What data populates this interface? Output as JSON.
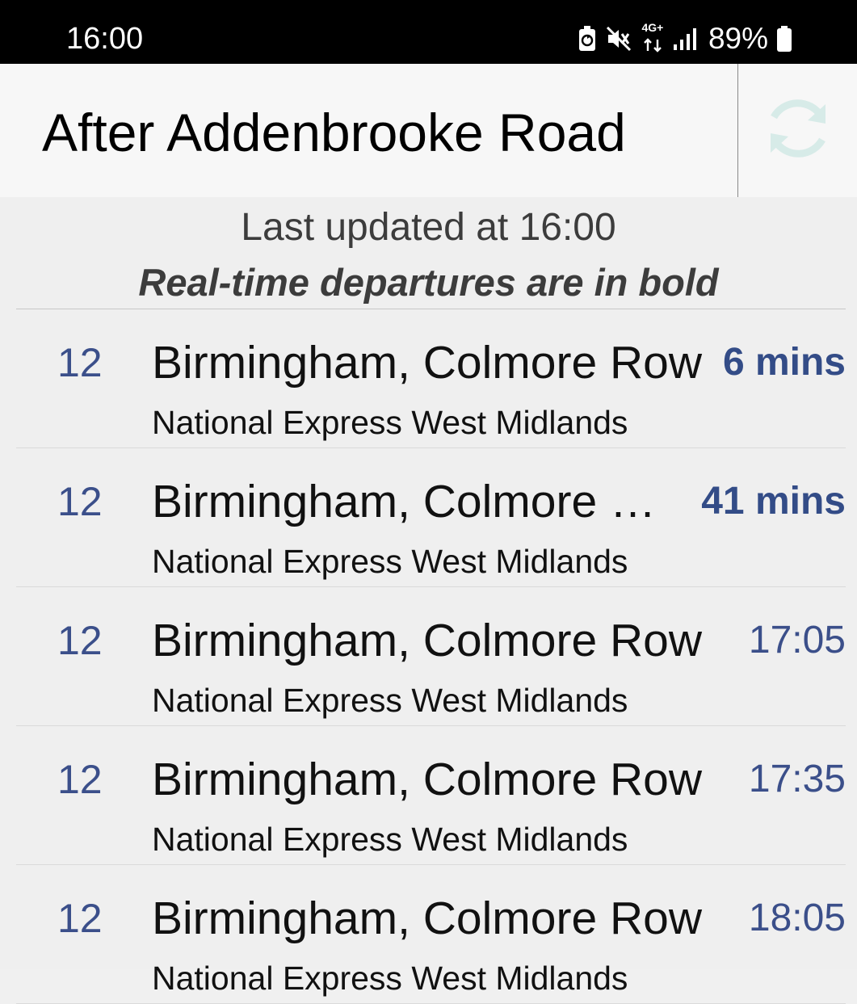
{
  "status_bar": {
    "time": "16:00",
    "network_type": "4G+",
    "battery_percent": "89%",
    "icons": [
      "recycle-battery-icon",
      "vibrate-mute-icon",
      "network-data-icon",
      "signal-icon",
      "battery-icon"
    ]
  },
  "app_bar": {
    "title": "After Addenbrooke Road",
    "refresh_icon": "refresh-icon"
  },
  "header": {
    "last_updated": "Last updated at 16:00",
    "realtime_note": "Real-time departures are in bold"
  },
  "departures": [
    {
      "route": "12",
      "destination": "Birmingham, Colmore Row",
      "operator": "National Express West Midlands",
      "time": "6 mins",
      "realtime": true
    },
    {
      "route": "12",
      "destination": "Birmingham, Colmore Row",
      "operator": "National Express West Midlands",
      "time": "41 mins",
      "realtime": true
    },
    {
      "route": "12",
      "destination": "Birmingham, Colmore Row",
      "operator": "National Express West Midlands",
      "time": "17:05",
      "realtime": false
    },
    {
      "route": "12",
      "destination": "Birmingham, Colmore Row",
      "operator": "National Express West Midlands",
      "time": "17:35",
      "realtime": false
    },
    {
      "route": "12",
      "destination": "Birmingham, Colmore Row",
      "operator": "National Express West Midlands",
      "time": "18:05",
      "realtime": false
    }
  ],
  "colors": {
    "accent": "#3b4f8a",
    "status_bar_bg": "#000000",
    "app_bar_bg": "#f7f7f7",
    "content_bg": "#efefef",
    "refresh_icon": "#d7ebe8"
  }
}
